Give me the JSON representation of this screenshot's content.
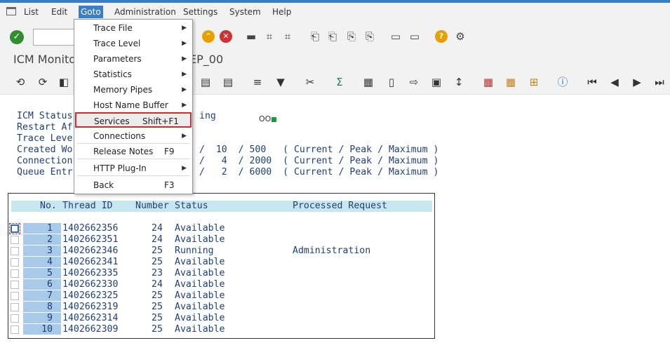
{
  "menubar": {
    "items": [
      {
        "label": "List"
      },
      {
        "label": "Edit"
      },
      {
        "label": "Goto"
      },
      {
        "label": "Administration"
      },
      {
        "label": "Settings"
      },
      {
        "label": "System"
      },
      {
        "label": "Help"
      }
    ]
  },
  "title": {
    "left": "ICM Monito",
    "right": "EP_00"
  },
  "goto_menu": {
    "items": [
      {
        "label": "Trace File",
        "shortcut": "",
        "submenu": true
      },
      {
        "label": "Trace Level",
        "shortcut": "",
        "submenu": true
      },
      {
        "label": "Parameters",
        "shortcut": "",
        "submenu": true
      },
      {
        "label": "Statistics",
        "shortcut": "",
        "submenu": true
      },
      {
        "label": "Memory Pipes",
        "shortcut": "",
        "submenu": true
      },
      {
        "label": "Host Name Buffer",
        "shortcut": "",
        "submenu": true
      },
      {
        "label": "Services",
        "shortcut": "Shift+F1",
        "submenu": false
      },
      {
        "label": "Connections",
        "shortcut": "",
        "submenu": true
      },
      {
        "label": "Release Notes",
        "shortcut": "F9",
        "submenu": false
      },
      {
        "label": "HTTP Plug-In",
        "shortcut": "",
        "submenu": true
      },
      {
        "label": "Back",
        "shortcut": "F3",
        "submenu": false
      }
    ],
    "arrow_glyph": "▶"
  },
  "info": {
    "icm_status_label": "ICM Status",
    "icm_status_value": "ing",
    "restart_label": "Restart Af",
    "trace_label": "Trace Leve",
    "created_label": "Created Wo",
    "created_values": "/  10  / 500   ( Current / Peak / Maximum )",
    "connection_label": "Connection",
    "connection_values": "/   4  / 2000  ( Current / Peak / Maximum )",
    "queue_label": "Queue Entr",
    "queue_values": "/   2  / 6000  ( Current / Peak / Maximum )",
    "status_indicator": "OO"
  },
  "table": {
    "headers": {
      "no": "No.",
      "thread": "Thread ID",
      "number": "Number",
      "status": "Status",
      "request": "Processed Request"
    },
    "rows": [
      {
        "no": "1",
        "thread": "1402662356",
        "number": "24",
        "status": "Available",
        "request": ""
      },
      {
        "no": "2",
        "thread": "1402662351",
        "number": "24",
        "status": "Available",
        "request": ""
      },
      {
        "no": "3",
        "thread": "1402662346",
        "number": "25",
        "status": "Running",
        "request": "Administration"
      },
      {
        "no": "4",
        "thread": "1402662341",
        "number": "25",
        "status": "Available",
        "request": ""
      },
      {
        "no": "5",
        "thread": "1402662335",
        "number": "23",
        "status": "Available",
        "request": ""
      },
      {
        "no": "6",
        "thread": "1402662330",
        "number": "24",
        "status": "Available",
        "request": ""
      },
      {
        "no": "7",
        "thread": "1402662325",
        "number": "25",
        "status": "Available",
        "request": ""
      },
      {
        "no": "8",
        "thread": "1402662319",
        "number": "25",
        "status": "Available",
        "request": ""
      },
      {
        "no": "9",
        "thread": "1402662314",
        "number": "25",
        "status": "Available",
        "request": ""
      },
      {
        "no": "10",
        "thread": "1402662309",
        "number": "25",
        "status": "Available",
        "request": ""
      }
    ]
  },
  "icons": {
    "toolbar1": [
      "enter-icon",
      "command-field",
      "save-icon",
      "up-icon",
      "cancel-icon",
      "print-icon",
      "find-icon",
      "find-next-icon",
      "first-page-icon",
      "previous-page-icon",
      "next-page-icon",
      "last-page-icon",
      "create-session-icon",
      "shortcut-icon",
      "help-icon",
      "customize-icon"
    ],
    "toolbar2": [
      "refresh-icon",
      "details-icon",
      "display-icon",
      "trace-icon",
      "log-icon",
      "align-icon",
      "filter-icon",
      "cut-icon",
      "sum-icon",
      "subtotal-icon",
      "export-icon",
      "import-icon",
      "mail-icon",
      "sort-icon",
      "layout-icon",
      "hierarchy-icon",
      "tree-icon",
      "info-icon",
      "first-icon",
      "prev-icon",
      "next-icon",
      "last-icon"
    ]
  },
  "colors": {
    "accent": "#3a7ec8",
    "header_row": "#c7e6ef",
    "number_cell": "#a8c9ea",
    "selection_border": "#d02a2a",
    "ok_green": "#2f8f2f"
  }
}
